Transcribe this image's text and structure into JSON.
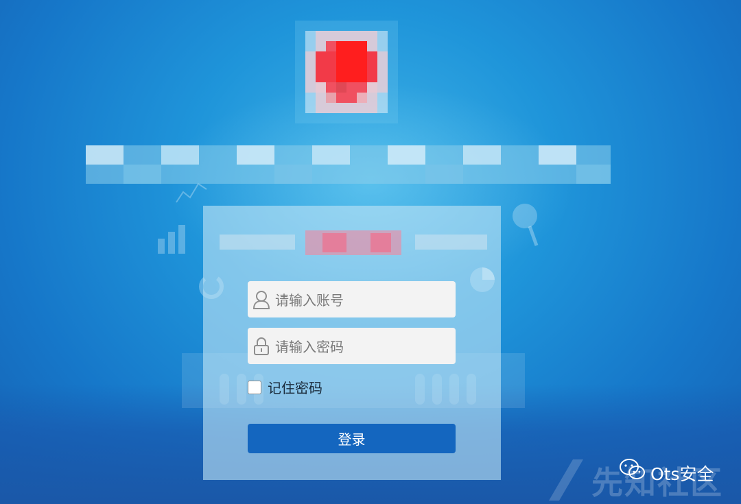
{
  "form": {
    "username_placeholder": "请输入账号",
    "password_placeholder": "请输入密码",
    "remember_label": "记住密码",
    "login_label": "登录"
  },
  "watermark": {
    "brand": "Ots安全",
    "site": "先知社区"
  },
  "icons": {
    "user": "user-icon",
    "lock": "lock-icon",
    "wechat": "wechat-icon"
  },
  "colors": {
    "background": "#1f95da",
    "login_button": "#1466bf",
    "input_bg": "#f3f3f3",
    "logo_red": "#ff2a2a"
  }
}
